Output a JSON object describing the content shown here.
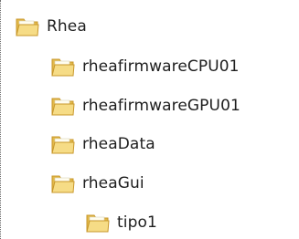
{
  "tree": {
    "items": [
      {
        "label": "Rhea",
        "icon": "folder-icon"
      },
      {
        "label": "rheafirmwareCPU01",
        "icon": "folder-icon"
      },
      {
        "label": "rheafirmwareGPU01",
        "icon": "folder-icon"
      },
      {
        "label": "rheaData",
        "icon": "folder-icon"
      },
      {
        "label": "rheaGui",
        "icon": "folder-icon"
      },
      {
        "label": "tipo1",
        "icon": "folder-icon"
      }
    ]
  },
  "colors": {
    "folder_back": "#e2b94a",
    "folder_front": "#f6dc86",
    "folder_edge": "#c8972a",
    "paper": "#fffdf0",
    "guide_line": "#6b6b6b"
  }
}
